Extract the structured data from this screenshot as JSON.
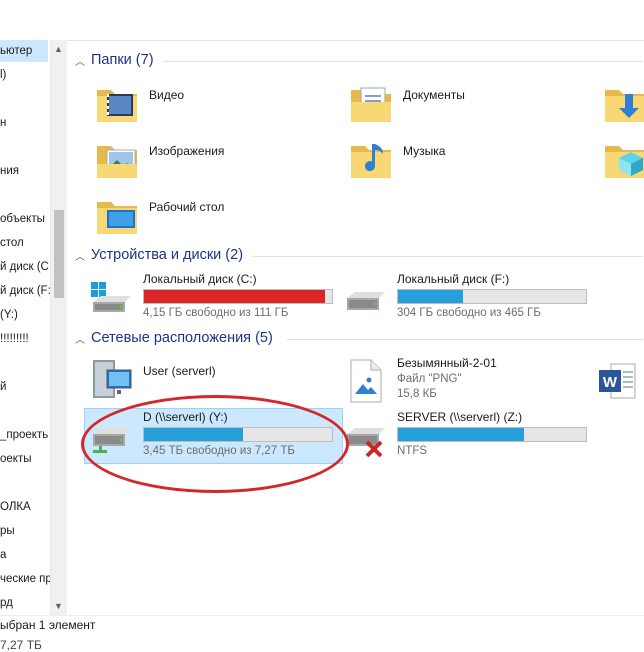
{
  "nav": {
    "items": [
      {
        "label": "ьютер",
        "selected": true
      },
      {
        "label": "l)"
      },
      {
        "label": ""
      },
      {
        "label": "н"
      },
      {
        "label": ""
      },
      {
        "label": "ния"
      },
      {
        "label": ""
      },
      {
        "label": "объекты"
      },
      {
        "label": "стол"
      },
      {
        "label": "й диск (C:"
      },
      {
        "label": "й диск (F:)"
      },
      {
        "label": "(Y:)"
      },
      {
        "label": "!!!!!!!!!"
      },
      {
        "label": ""
      },
      {
        "label": "й"
      },
      {
        "label": ""
      },
      {
        "label": "_проекть"
      },
      {
        "label": "оекты"
      },
      {
        "label": ""
      },
      {
        "label": "ОЛКА"
      },
      {
        "label": "ры"
      },
      {
        "label": "а"
      },
      {
        "label": "ческие пр"
      },
      {
        "label": "рд"
      }
    ]
  },
  "groups": {
    "folders": {
      "title": "Папки (7)"
    },
    "devices": {
      "title": "Устройства и диски (2)"
    },
    "network": {
      "title": "Сетевые расположения (5)"
    }
  },
  "folders": [
    {
      "name": "Видео",
      "icon": "video-folder-icon"
    },
    {
      "name": "Документы",
      "icon": "documents-folder-icon"
    },
    {
      "name": "",
      "icon": "downloads-folder-icon"
    },
    {
      "name": "Изображения",
      "icon": "pictures-folder-icon"
    },
    {
      "name": "Музыка",
      "icon": "music-folder-icon"
    },
    {
      "name": "",
      "icon": "3d-objects-folder-icon"
    },
    {
      "name": "Рабочий стол",
      "icon": "desktop-folder-icon"
    }
  ],
  "drives": [
    {
      "name": "Локальный диск (C:)",
      "free": "4,15 ГБ свободно из 111 ГБ",
      "used_fraction": 0.963,
      "bar_color": "#da2626"
    },
    {
      "name": "Локальный диск (F:)",
      "free": "304 ГБ свободно из 465 ГБ",
      "used_fraction": 0.346,
      "bar_color": "#26a0da"
    }
  ],
  "network": [
    {
      "name": "User (serverl)"
    },
    {
      "name": "Безымянный-2-01",
      "type": "Файл \"PNG\"",
      "size": "15,8 КБ"
    },
    {
      "name": "D (\\\\serverl) (Y:)",
      "free": "3,45 ТБ свободно из 7,27 ТБ",
      "used_fraction": 0.525,
      "bar_color": "#26a0da"
    },
    {
      "name": "SERVER (\\\\serverl) (Z:)",
      "fs": "NTFS",
      "used_fraction": 0.67,
      "bar_color": "#26a0da"
    }
  ],
  "status": {
    "selected": "ыбран 1 элемент",
    "cut": "7,27 ТБ"
  }
}
